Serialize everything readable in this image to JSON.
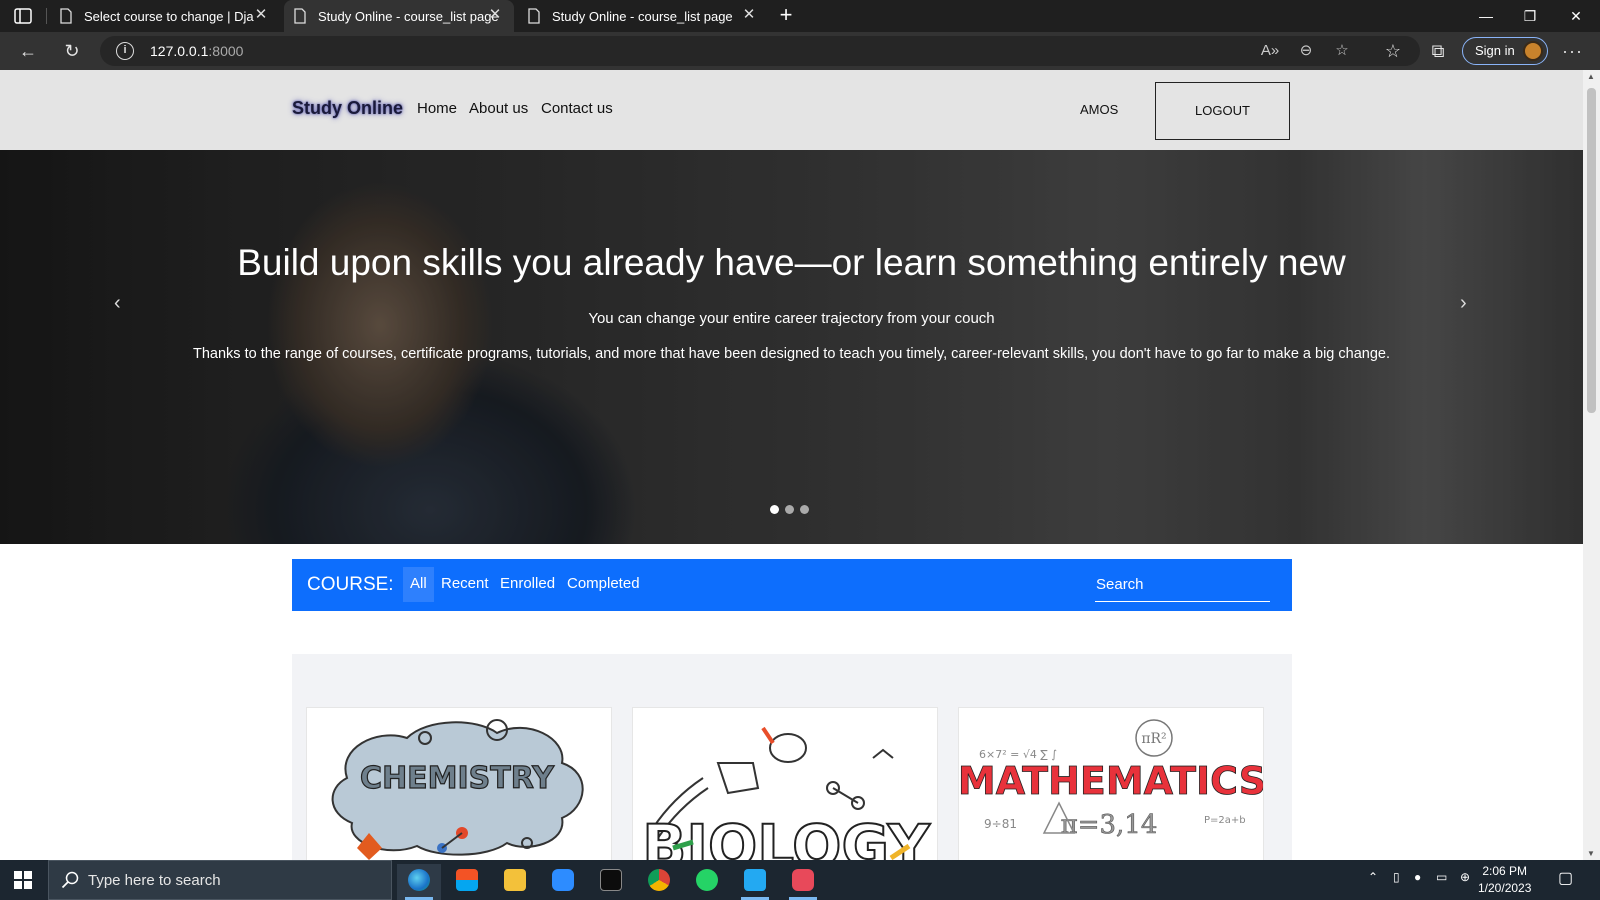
{
  "browser": {
    "tabs": [
      {
        "title": "Select course to change | Django",
        "active": false
      },
      {
        "title": "Study Online - course_list page",
        "active": true
      },
      {
        "title": "Study Online - course_list page",
        "active": false
      }
    ],
    "url_host": "127.0.0.1",
    "url_port": ":8000",
    "signin_label": "Sign in"
  },
  "navbar": {
    "brand": "Study Online",
    "links": [
      "Home",
      "About us",
      "Contact us"
    ],
    "username": "AMOS",
    "logout_label": "LOGOUT"
  },
  "hero": {
    "headline": "Build upon skills you already have—or learn something entirely new",
    "subheadline": "You can change your entire career trajectory from your couch",
    "description": "Thanks to the range of courses, certificate programs, tutorials, and more that have been designed to teach you timely, career-relevant skills, you don't have to go far to make a big change.",
    "prev_arrow": "‹",
    "next_arrow": "›",
    "slide_count": 3,
    "active_slide": 1
  },
  "course_filter": {
    "label": "COURSE:",
    "tabs": [
      "All",
      "Recent",
      "Enrolled",
      "Completed"
    ],
    "active_tab": "All",
    "search_placeholder": "Search"
  },
  "courses": [
    {
      "image_text": "CHEMISTRY"
    },
    {
      "image_text": "BIOLOGY"
    },
    {
      "image_text": "MATHEMATICS"
    }
  ],
  "taskbar": {
    "search_placeholder": "Type here to search",
    "time": "2:06 PM",
    "date": "1/20/2023"
  },
  "colors": {
    "primary": "#0d6efd",
    "navbar_bg": "#e4e4e4",
    "taskbar_bg": "#1c2630"
  }
}
